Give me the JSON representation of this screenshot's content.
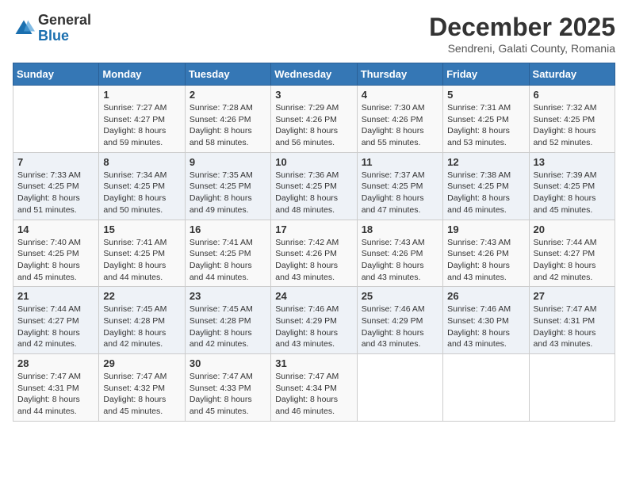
{
  "logo": {
    "general": "General",
    "blue": "Blue"
  },
  "title": "December 2025",
  "subtitle": "Sendreni, Galati County, Romania",
  "days_header": [
    "Sunday",
    "Monday",
    "Tuesday",
    "Wednesday",
    "Thursday",
    "Friday",
    "Saturday"
  ],
  "weeks": [
    [
      {
        "day": "",
        "sunrise": "",
        "sunset": "",
        "daylight": ""
      },
      {
        "day": "1",
        "sunrise": "Sunrise: 7:27 AM",
        "sunset": "Sunset: 4:27 PM",
        "daylight": "Daylight: 8 hours and 59 minutes."
      },
      {
        "day": "2",
        "sunrise": "Sunrise: 7:28 AM",
        "sunset": "Sunset: 4:26 PM",
        "daylight": "Daylight: 8 hours and 58 minutes."
      },
      {
        "day": "3",
        "sunrise": "Sunrise: 7:29 AM",
        "sunset": "Sunset: 4:26 PM",
        "daylight": "Daylight: 8 hours and 56 minutes."
      },
      {
        "day": "4",
        "sunrise": "Sunrise: 7:30 AM",
        "sunset": "Sunset: 4:26 PM",
        "daylight": "Daylight: 8 hours and 55 minutes."
      },
      {
        "day": "5",
        "sunrise": "Sunrise: 7:31 AM",
        "sunset": "Sunset: 4:25 PM",
        "daylight": "Daylight: 8 hours and 53 minutes."
      },
      {
        "day": "6",
        "sunrise": "Sunrise: 7:32 AM",
        "sunset": "Sunset: 4:25 PM",
        "daylight": "Daylight: 8 hours and 52 minutes."
      }
    ],
    [
      {
        "day": "7",
        "sunrise": "Sunrise: 7:33 AM",
        "sunset": "Sunset: 4:25 PM",
        "daylight": "Daylight: 8 hours and 51 minutes."
      },
      {
        "day": "8",
        "sunrise": "Sunrise: 7:34 AM",
        "sunset": "Sunset: 4:25 PM",
        "daylight": "Daylight: 8 hours and 50 minutes."
      },
      {
        "day": "9",
        "sunrise": "Sunrise: 7:35 AM",
        "sunset": "Sunset: 4:25 PM",
        "daylight": "Daylight: 8 hours and 49 minutes."
      },
      {
        "day": "10",
        "sunrise": "Sunrise: 7:36 AM",
        "sunset": "Sunset: 4:25 PM",
        "daylight": "Daylight: 8 hours and 48 minutes."
      },
      {
        "day": "11",
        "sunrise": "Sunrise: 7:37 AM",
        "sunset": "Sunset: 4:25 PM",
        "daylight": "Daylight: 8 hours and 47 minutes."
      },
      {
        "day": "12",
        "sunrise": "Sunrise: 7:38 AM",
        "sunset": "Sunset: 4:25 PM",
        "daylight": "Daylight: 8 hours and 46 minutes."
      },
      {
        "day": "13",
        "sunrise": "Sunrise: 7:39 AM",
        "sunset": "Sunset: 4:25 PM",
        "daylight": "Daylight: 8 hours and 45 minutes."
      }
    ],
    [
      {
        "day": "14",
        "sunrise": "Sunrise: 7:40 AM",
        "sunset": "Sunset: 4:25 PM",
        "daylight": "Daylight: 8 hours and 45 minutes."
      },
      {
        "day": "15",
        "sunrise": "Sunrise: 7:41 AM",
        "sunset": "Sunset: 4:25 PM",
        "daylight": "Daylight: 8 hours and 44 minutes."
      },
      {
        "day": "16",
        "sunrise": "Sunrise: 7:41 AM",
        "sunset": "Sunset: 4:25 PM",
        "daylight": "Daylight: 8 hours and 44 minutes."
      },
      {
        "day": "17",
        "sunrise": "Sunrise: 7:42 AM",
        "sunset": "Sunset: 4:26 PM",
        "daylight": "Daylight: 8 hours and 43 minutes."
      },
      {
        "day": "18",
        "sunrise": "Sunrise: 7:43 AM",
        "sunset": "Sunset: 4:26 PM",
        "daylight": "Daylight: 8 hours and 43 minutes."
      },
      {
        "day": "19",
        "sunrise": "Sunrise: 7:43 AM",
        "sunset": "Sunset: 4:26 PM",
        "daylight": "Daylight: 8 hours and 43 minutes."
      },
      {
        "day": "20",
        "sunrise": "Sunrise: 7:44 AM",
        "sunset": "Sunset: 4:27 PM",
        "daylight": "Daylight: 8 hours and 42 minutes."
      }
    ],
    [
      {
        "day": "21",
        "sunrise": "Sunrise: 7:44 AM",
        "sunset": "Sunset: 4:27 PM",
        "daylight": "Daylight: 8 hours and 42 minutes."
      },
      {
        "day": "22",
        "sunrise": "Sunrise: 7:45 AM",
        "sunset": "Sunset: 4:28 PM",
        "daylight": "Daylight: 8 hours and 42 minutes."
      },
      {
        "day": "23",
        "sunrise": "Sunrise: 7:45 AM",
        "sunset": "Sunset: 4:28 PM",
        "daylight": "Daylight: 8 hours and 42 minutes."
      },
      {
        "day": "24",
        "sunrise": "Sunrise: 7:46 AM",
        "sunset": "Sunset: 4:29 PM",
        "daylight": "Daylight: 8 hours and 43 minutes."
      },
      {
        "day": "25",
        "sunrise": "Sunrise: 7:46 AM",
        "sunset": "Sunset: 4:29 PM",
        "daylight": "Daylight: 8 hours and 43 minutes."
      },
      {
        "day": "26",
        "sunrise": "Sunrise: 7:46 AM",
        "sunset": "Sunset: 4:30 PM",
        "daylight": "Daylight: 8 hours and 43 minutes."
      },
      {
        "day": "27",
        "sunrise": "Sunrise: 7:47 AM",
        "sunset": "Sunset: 4:31 PM",
        "daylight": "Daylight: 8 hours and 43 minutes."
      }
    ],
    [
      {
        "day": "28",
        "sunrise": "Sunrise: 7:47 AM",
        "sunset": "Sunset: 4:31 PM",
        "daylight": "Daylight: 8 hours and 44 minutes."
      },
      {
        "day": "29",
        "sunrise": "Sunrise: 7:47 AM",
        "sunset": "Sunset: 4:32 PM",
        "daylight": "Daylight: 8 hours and 45 minutes."
      },
      {
        "day": "30",
        "sunrise": "Sunrise: 7:47 AM",
        "sunset": "Sunset: 4:33 PM",
        "daylight": "Daylight: 8 hours and 45 minutes."
      },
      {
        "day": "31",
        "sunrise": "Sunrise: 7:47 AM",
        "sunset": "Sunset: 4:34 PM",
        "daylight": "Daylight: 8 hours and 46 minutes."
      },
      {
        "day": "",
        "sunrise": "",
        "sunset": "",
        "daylight": ""
      },
      {
        "day": "",
        "sunrise": "",
        "sunset": "",
        "daylight": ""
      },
      {
        "day": "",
        "sunrise": "",
        "sunset": "",
        "daylight": ""
      }
    ]
  ]
}
